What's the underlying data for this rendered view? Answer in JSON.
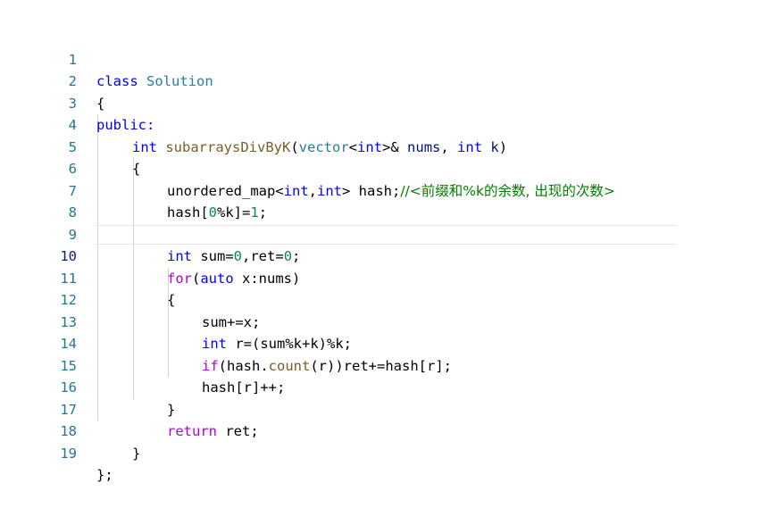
{
  "editor": {
    "current_line": 10,
    "line_numbers": [
      "1",
      "2",
      "3",
      "4",
      "5",
      "6",
      "7",
      "8",
      "9",
      "10",
      "11",
      "12",
      "13",
      "14",
      "15",
      "16",
      "17",
      "18",
      "19"
    ],
    "lines": {
      "l1": [
        "class",
        " ",
        "Solution"
      ],
      "l2": [
        "{"
      ],
      "l3": [
        "public:"
      ],
      "l4": [
        "int",
        " ",
        "subarraysDivByK",
        "(",
        "vector",
        "<",
        "int",
        ">&",
        " ",
        "nums",
        ", ",
        "int",
        " ",
        "k",
        ")"
      ],
      "l5": [
        "{"
      ],
      "l6": [
        "unordered_map<",
        "int",
        ",",
        "int",
        "> hash;",
        "//<前缀和%k的余数, 出现的次数>"
      ],
      "l7": [
        "hash[",
        "0",
        "%k]=",
        "1",
        ";"
      ],
      "l8": [
        ""
      ],
      "l9": [
        "int",
        " sum=",
        "0",
        ",ret=",
        "0",
        ";"
      ],
      "l10": [
        "for",
        "(",
        "auto",
        " x:nums)"
      ],
      "l11": [
        "{"
      ],
      "l12": [
        "sum+=x;"
      ],
      "l13": [
        "int",
        " r=(sum%k+k)%k;"
      ],
      "l14": [
        "if",
        "(hash.",
        "count",
        "(r))ret+=hash[r];"
      ],
      "l15": [
        "hash[r]++;"
      ],
      "l16": [
        "}"
      ],
      "l17": [
        "return",
        " ret;"
      ],
      "l18": [
        "}"
      ],
      "l19": [
        "};"
      ]
    }
  },
  "colors": {
    "keyword": "#0000ff",
    "control": "#af00db",
    "type": "#267f99",
    "function": "#795e26",
    "variable": "#001080",
    "number": "#098658",
    "comment": "#008000",
    "line_number": "#237893"
  }
}
